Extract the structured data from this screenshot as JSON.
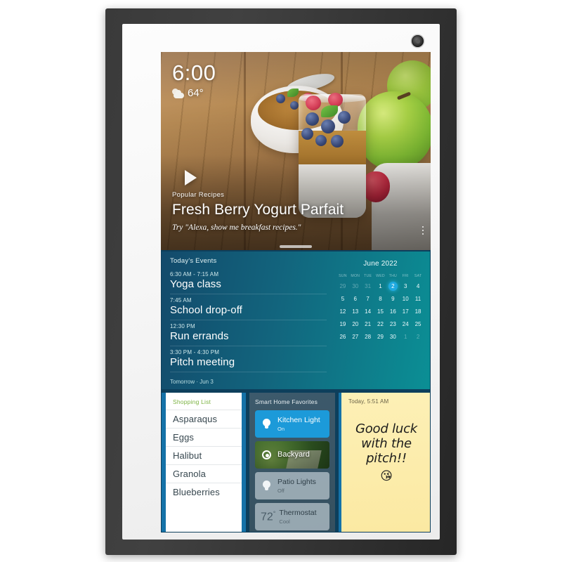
{
  "device": {
    "camera_icon": "camera-lens"
  },
  "hero": {
    "clock": "6:00",
    "temperature": "64°",
    "weather_icon": "sun-behind-cloud-icon",
    "play_icon": "play-icon",
    "kicker": "Popular Recipes",
    "title": "Fresh Berry Yogurt Parfait",
    "hint": "Try \"Alexa, show me breakfast recipes.\"",
    "overflow_icon": "kebab-menu-icon"
  },
  "events": {
    "heading": "Today's Events",
    "items": [
      {
        "time": "6:30 AM - 7:15 AM",
        "title": "Yoga class"
      },
      {
        "time": "7:45 AM",
        "title": "School drop-off"
      },
      {
        "time": "12:30 PM",
        "title": "Run errands"
      },
      {
        "time": "3:30 PM - 4:30 PM",
        "title": "Pitch meeting"
      }
    ],
    "footer": "Tomorrow · Jun 3"
  },
  "calendar": {
    "title": "June 2022",
    "dow": [
      "SUN",
      "MON",
      "TUE",
      "WED",
      "THU",
      "FRI",
      "SAT"
    ],
    "today": 2,
    "weeks": [
      [
        {
          "d": "29",
          "dim": true
        },
        {
          "d": "30",
          "dim": true
        },
        {
          "d": "31",
          "dim": true
        },
        {
          "d": "1"
        },
        {
          "d": "2",
          "today": true
        },
        {
          "d": "3"
        },
        {
          "d": "4"
        }
      ],
      [
        {
          "d": "5"
        },
        {
          "d": "6"
        },
        {
          "d": "7"
        },
        {
          "d": "8"
        },
        {
          "d": "9"
        },
        {
          "d": "10"
        },
        {
          "d": "11"
        }
      ],
      [
        {
          "d": "12"
        },
        {
          "d": "13"
        },
        {
          "d": "14"
        },
        {
          "d": "15"
        },
        {
          "d": "16"
        },
        {
          "d": "17"
        },
        {
          "d": "18"
        }
      ],
      [
        {
          "d": "19"
        },
        {
          "d": "20"
        },
        {
          "d": "21"
        },
        {
          "d": "22"
        },
        {
          "d": "23"
        },
        {
          "d": "24"
        },
        {
          "d": "25"
        }
      ],
      [
        {
          "d": "26"
        },
        {
          "d": "27"
        },
        {
          "d": "28"
        },
        {
          "d": "29"
        },
        {
          "d": "30"
        },
        {
          "d": "1",
          "dim": true
        },
        {
          "d": "2",
          "dim": true
        }
      ]
    ]
  },
  "shopping": {
    "heading": "Shopping List",
    "items": [
      "Asparaqus",
      "Eggs",
      "Halibut",
      "Granola",
      "Blueberries"
    ]
  },
  "smart_home": {
    "heading": "Smart Home Favorites",
    "cards": [
      {
        "name": "Kitchen Light",
        "state": "On",
        "icon": "lightbulb-icon",
        "style": "on"
      },
      {
        "name": "Backyard",
        "state": "",
        "icon": "camera-icon",
        "style": "cam"
      },
      {
        "name": "Patio Lights",
        "state": "Off",
        "icon": "lightbulb-icon",
        "style": "off"
      },
      {
        "name": "Thermostat",
        "state": "Cool",
        "temp": "72",
        "icon": "thermostat-icon",
        "style": "off"
      }
    ]
  },
  "note": {
    "timestamp": "Today, 5:51 AM",
    "line1": "Good luck",
    "line2": "with the",
    "line3": "pitch!!",
    "emoji": "😘"
  },
  "colors": {
    "accent_blue": "#1c9ad9",
    "frame_dark": "#363636",
    "panel_border": "#1572a8",
    "note_yellow": "#fbe9a2",
    "shopping_green": "#7cb342"
  }
}
